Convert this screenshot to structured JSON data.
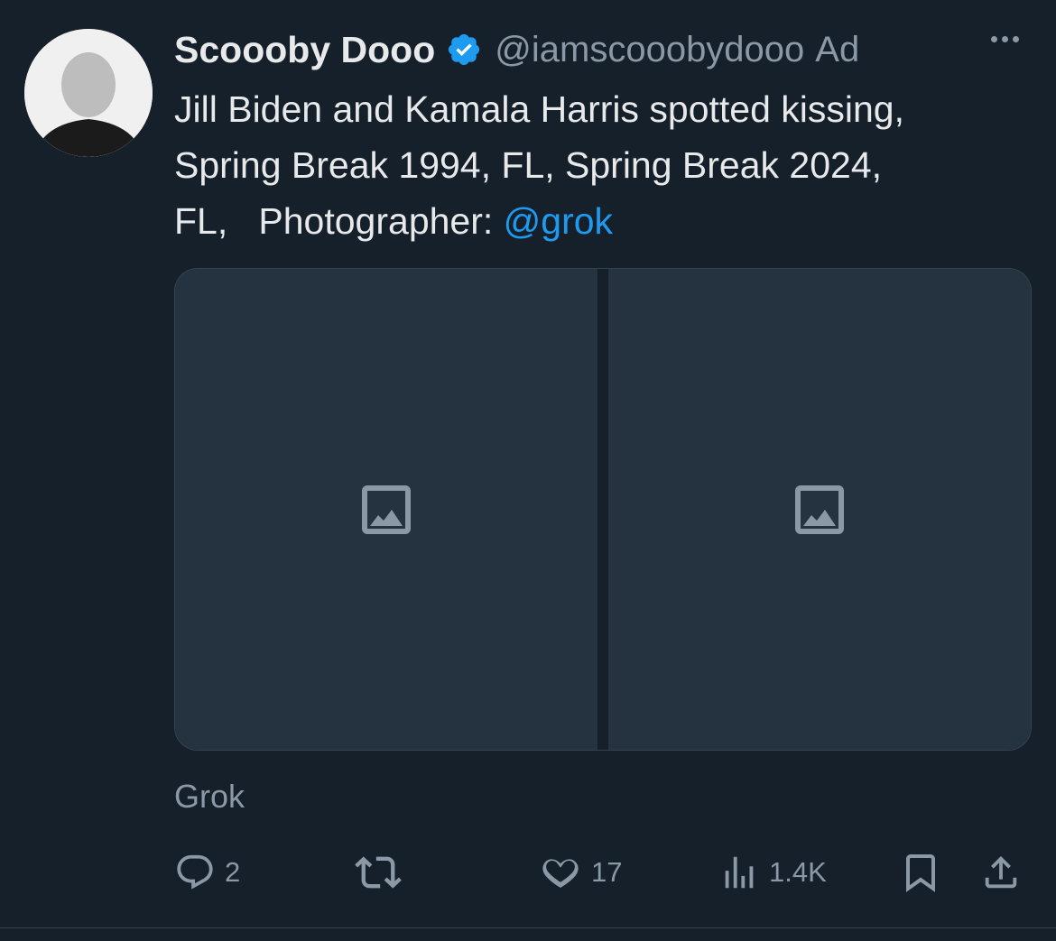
{
  "tweet": {
    "author_name": "Scoooby Dooo",
    "handle": "@iamscooobydooo",
    "ad_label": "Ad",
    "text_line1": "Jill Biden and Kamala Harris spotted kissing,",
    "text_line2": "Spring Break 1994, FL, Spring Break 2024,",
    "text_line3_prefix": "FL,   Photographer: ",
    "mention": "@grok",
    "media_source": "Grok"
  },
  "actions": {
    "replies": "2",
    "likes": "17",
    "views": "1.4K"
  },
  "colors": {
    "background": "#15202b",
    "accent": "#1d9bf0",
    "muted": "#8b98a5",
    "text": "#e7e9ea"
  },
  "icons": [
    "more-icon",
    "verified-icon",
    "reply-icon",
    "retweet-icon",
    "like-icon",
    "views-icon",
    "bookmark-icon",
    "share-icon"
  ]
}
